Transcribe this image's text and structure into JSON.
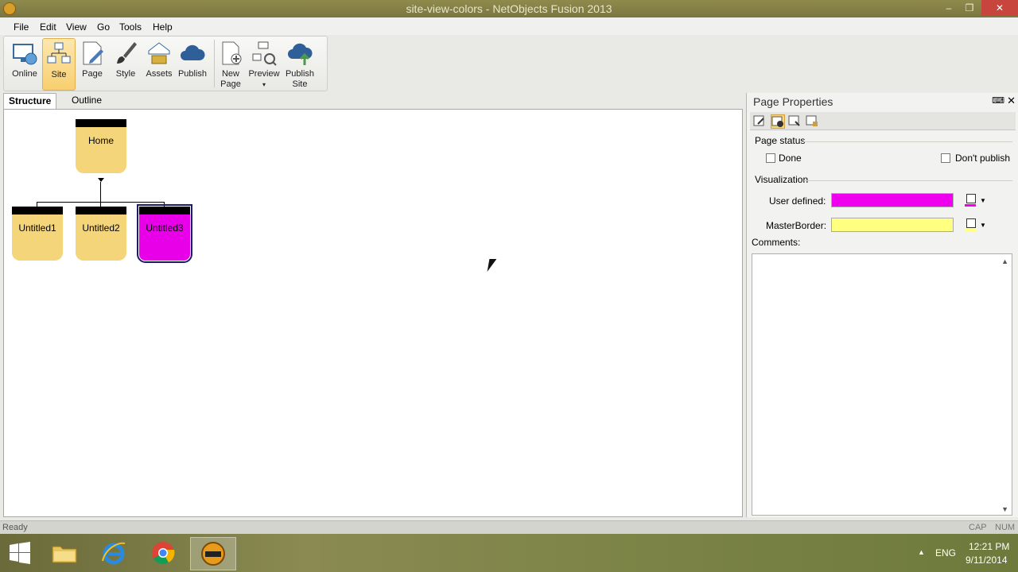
{
  "window": {
    "title": "site-view-colors - NetObjects Fusion 2013"
  },
  "menu": [
    "File",
    "Edit",
    "View",
    "Go",
    "Tools",
    "Help"
  ],
  "ribbon": {
    "buttons": [
      {
        "label": "Online",
        "icon": "monitor-globe-icon"
      },
      {
        "label": "Site",
        "icon": "site-tree-icon",
        "active": true
      },
      {
        "label": "Page",
        "icon": "page-pencil-icon"
      },
      {
        "label": "Style",
        "icon": "brush-icon"
      },
      {
        "label": "Assets",
        "icon": "assets-icon"
      },
      {
        "label": "Publish",
        "icon": "cloud-icon"
      },
      {
        "label": "New Page",
        "line1": "New",
        "line2": "Page",
        "icon": "new-page-icon"
      },
      {
        "label": "Preview",
        "icon": "preview-icon"
      },
      {
        "label": "Publish Site",
        "line1": "Publish",
        "line2": "Site",
        "icon": "cloud-upload-icon"
      }
    ]
  },
  "tabs": [
    {
      "label": "Structure",
      "selected": true
    },
    {
      "label": "Outline",
      "selected": false
    }
  ],
  "structure": {
    "root": {
      "label": "Home",
      "color": "#f5d57a"
    },
    "children": [
      {
        "label": "Untitled1",
        "color": "#f5d57a"
      },
      {
        "label": "Untitled2",
        "color": "#f5d57a"
      },
      {
        "label": "Untitled3",
        "color": "#e800e8",
        "selected": true
      }
    ]
  },
  "properties": {
    "title": "Page Properties",
    "page_status_heading": "Page status",
    "done_label": "Done",
    "dont_publish_label": "Don't publish",
    "visualization_heading": "Visualization",
    "user_defined_label": "User defined:",
    "user_defined_color": "#ee00ee",
    "masterborder_label": "MasterBorder:",
    "masterborder_color": "#ffff80",
    "comments_label": "Comments:"
  },
  "status": {
    "ready": "Ready",
    "cap": "CAP",
    "num": "NUM"
  },
  "taskbar": {
    "language": "ENG",
    "time": "12:21 PM",
    "date": "9/11/2014"
  }
}
